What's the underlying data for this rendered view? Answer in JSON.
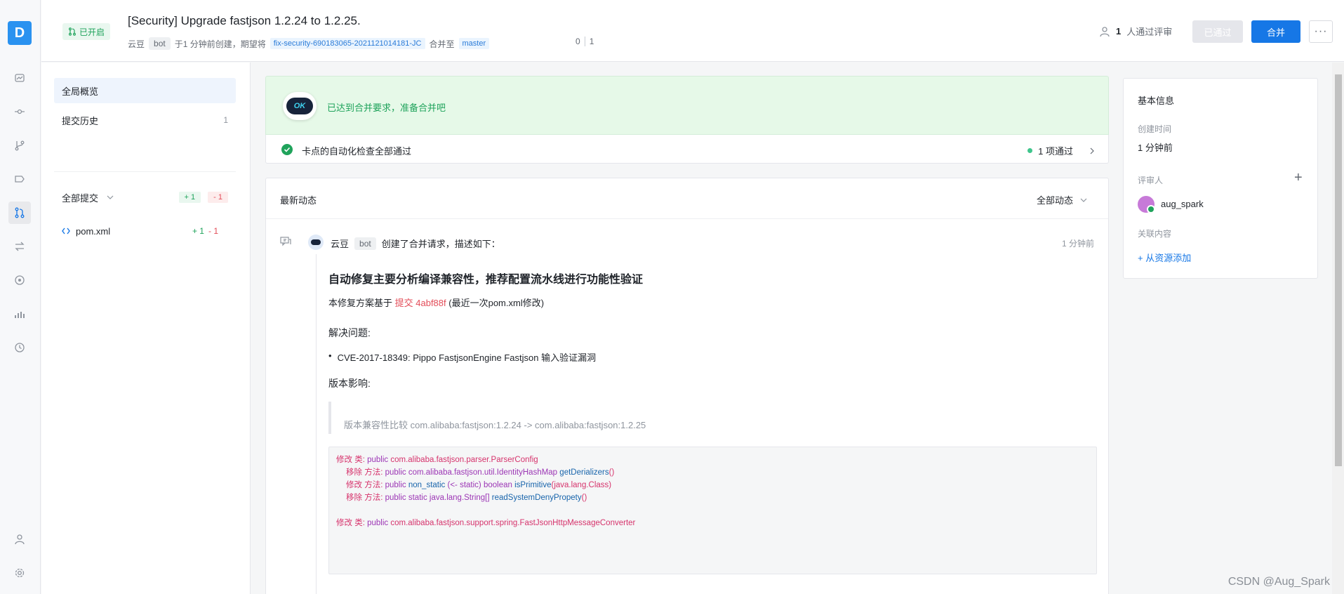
{
  "rail": {
    "logo_letter": "D",
    "icons": [
      "dashboard-icon",
      "commit-icon",
      "branch-icon",
      "tag-icon",
      "merge-request-icon",
      "compare-icon",
      "deploy-icon",
      "chart-icon",
      "history-icon",
      "user-icon",
      "gear-icon"
    ]
  },
  "header": {
    "status": "已开启",
    "title": "[Security] Upgrade fastjson 1.2.24 to 1.2.25.",
    "author": "云豆",
    "bot_tag": "bot",
    "created_text": "于1 分钟前创建，期望将",
    "source_branch": "fix-security-690183065-2021121014181-JC",
    "merge_into": "合并至",
    "target_branch": "master",
    "commits_left": "0",
    "commits_right": "1",
    "reviewer_count": "1",
    "reviewer_text": "人通过评审",
    "approved_button": "已通过",
    "merge_button": "合并",
    "more_button": "···"
  },
  "leftnav": {
    "overview": "全局概览",
    "commits_label": "提交历史",
    "commits_count": "1",
    "all_commits": "全部提交",
    "plus": "+ 1",
    "minus": "- 1",
    "file_name": "pom.xml",
    "file_plus": "+ 1",
    "file_minus": "- 1"
  },
  "ready": {
    "ok_text": "OK",
    "message": "已达到合并要求，准备合并吧"
  },
  "checks": {
    "message": "卡点的自动化检查全部通过",
    "summary": "1 项通过"
  },
  "activity": {
    "title": "最新动态",
    "filter": "全部动态",
    "event": {
      "author": "云豆",
      "bot_tag": "bot",
      "action": "创建了合并请求，描述如下：",
      "time": "1 分钟前"
    },
    "description": {
      "heading": "自动修复主要分析编译兼容性，推荐配置流水线进行功能性验证",
      "basis_prefix": "本修复方案基于",
      "basis_link": "提交 4abf88f",
      "basis_suffix": "(最近一次pom.xml修改)",
      "issues_title": "解决问题:",
      "issue_item": "CVE-2017-18349: Pippo FastjsonEngine Fastjson 输入验证漏洞",
      "impact_title": "版本影响:",
      "quote": "版本兼容性比较 com.alibaba:fastjson:1.2.24 -> com.alibaba:fastjson:1.2.25",
      "code": {
        "l1_a": "修改 类:",
        "l1_b": "public",
        "l1_c": "com.alibaba.fastjson.parser.ParserConfig",
        "l2_a": "移除 方法:",
        "l2_b": "public",
        "l2_c": "com.alibaba.fastjson.util.IdentityHashMap",
        "l2_d": "getDerializers",
        "l2_e": "()",
        "l3_a": "修改 方法:",
        "l3_b": "public",
        "l3_c": "non_static",
        "l3_d": "(<- static)",
        "l3_e": "boolean",
        "l3_f": "isPrimitive",
        "l3_g": "(java.lang.Class)",
        "l4_a": "移除 方法:",
        "l4_b": "public",
        "l4_c": "static",
        "l4_d": "java.lang.String[]",
        "l4_e": "readSystemDenyPropety",
        "l4_f": "()",
        "l5_a": "修改 类:",
        "l5_b": "public",
        "l5_c": "com.alibaba.fastjson.support.spring.FastJsonHttpMessageConverter"
      }
    }
  },
  "info": {
    "title": "基本信息",
    "created_label": "创建时间",
    "created_value": "1 分钟前",
    "reviewers_label": "评审人",
    "reviewer_name": "aug_spark",
    "related_label": "关联内容",
    "add_resource": "+ 从资源添加"
  },
  "watermark": "CSDN @Aug_Spark",
  "colors": {
    "accent": "#1677e6",
    "success": "#1fa35b",
    "danger": "#e34d59"
  }
}
